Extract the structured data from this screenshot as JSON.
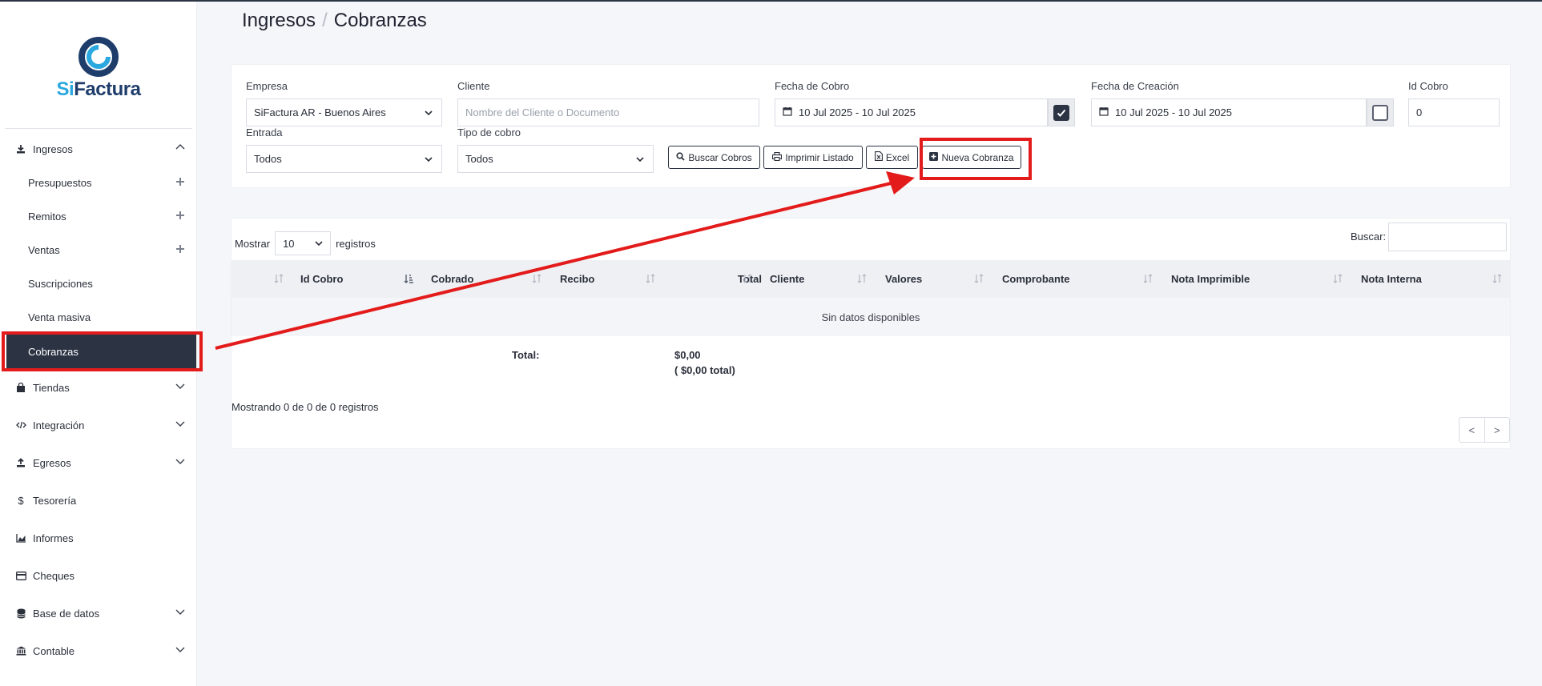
{
  "app": {
    "logo_si": "Si",
    "logo_factura": "Factura"
  },
  "breadcrumb": {
    "section": "Ingresos",
    "separator": "/",
    "page": "Cobranzas"
  },
  "sidebar": {
    "ingresos": "Ingresos",
    "presupuestos": "Presupuestos",
    "remitos": "Remitos",
    "ventas": "Ventas",
    "suscripciones": "Suscripciones",
    "venta_masiva": "Venta masiva",
    "cobranzas": "Cobranzas",
    "tiendas": "Tiendas",
    "integracion": "Integración",
    "egresos": "Egresos",
    "tesoreria": "Tesorería",
    "informes": "Informes",
    "cheques": "Cheques",
    "base_datos": "Base de datos",
    "contable": "Contable"
  },
  "filters": {
    "empresa_label": "Empresa",
    "empresa_value": "SiFactura AR - Buenos Aires",
    "cliente_label": "Cliente",
    "cliente_placeholder": "Nombre del Cliente o Documento",
    "fecha_cobro_label": "Fecha de Cobro",
    "fecha_cobro_value": "10 Jul 2025 - 10 Jul 2025",
    "fecha_cobro_checked": true,
    "fecha_creacion_label": "Fecha de Creación",
    "fecha_creacion_value": "10 Jul 2025 - 10 Jul 2025",
    "fecha_creacion_checked": false,
    "id_cobro_label": "Id Cobro",
    "id_cobro_value": "0",
    "entrada_label": "Entrada",
    "entrada_value": "Todos",
    "tipo_label": "Tipo de cobro",
    "tipo_value": "Todos"
  },
  "buttons": {
    "buscar": "Buscar Cobros",
    "imprimir": "Imprimir Listado",
    "excel": "Excel",
    "nueva": "Nueva Cobranza"
  },
  "table": {
    "mostrar": "Mostrar",
    "page_size": "10",
    "registros": "registros",
    "buscar_label": "Buscar:",
    "columns": [
      "Id Cobro",
      "Cobrado",
      "Recibo",
      "Total",
      "Cliente",
      "Valores",
      "Comprobante",
      "Nota Imprimible",
      "Nota Interna"
    ],
    "empty": "Sin datos disponibles",
    "total_label": "Total:",
    "total_value": "$0,00",
    "total_sub": "( $0,00 total)",
    "info": "Mostrando 0 de 0 de 0 registros",
    "prev": "<",
    "next": ">"
  },
  "colors": {
    "dark": "#2c3444",
    "highlight": "#e31b1b",
    "brand_light": "#2aa8df",
    "brand_dark": "#1f3d6b"
  }
}
